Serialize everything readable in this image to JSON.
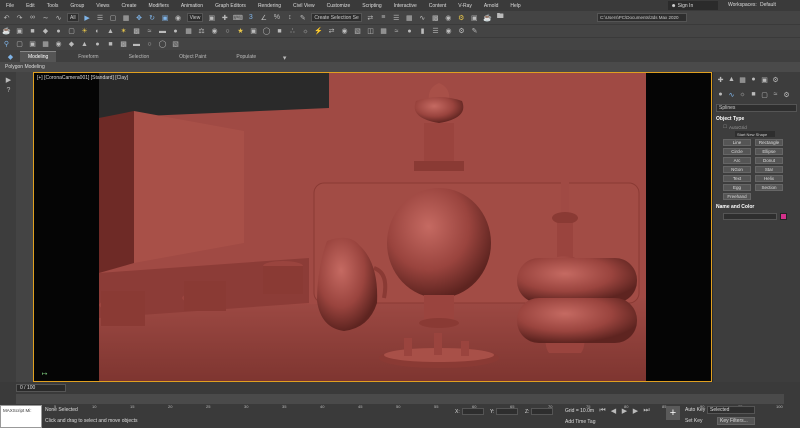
{
  "menubar": {
    "items": [
      "File",
      "Edit",
      "Tools",
      "Group",
      "Views",
      "Create",
      "Modifiers",
      "Animation",
      "Graph Editors",
      "Rendering",
      "Civil View",
      "Customize",
      "Scripting",
      "Interactive",
      "Content",
      "V-Ray",
      "Arnold",
      "Help"
    ],
    "sign_in": "Sign In",
    "workspaces_label": "Workspaces:",
    "workspace_value": "Default"
  },
  "toolbar": {
    "filter_value": "All",
    "view_value": "View",
    "selection_set": "Create Selection Se",
    "project_path": "C:\\Users\\PC\\Documents\\3ds Max 2020"
  },
  "ribbon": {
    "tabs": [
      "Modeling",
      "Freeform",
      "Selection",
      "Object Paint",
      "Populate"
    ],
    "sub_label": "Polygon Modeling"
  },
  "viewport": {
    "label": "[+] [CoronaCamera001] [Standard] [Clay]",
    "colors": {
      "bg": "#050505",
      "clay": "#a04a44",
      "border": "#e0a020"
    }
  },
  "command_panel": {
    "category": "Splines",
    "object_type_title": "Object Type",
    "autogrid": "AutoGrid",
    "start_new_shape": "Start New Shape",
    "buttons": [
      "Line",
      "Rectangle",
      "Circle",
      "Ellipse",
      "Arc",
      "Donut",
      "NGon",
      "Star",
      "Text",
      "Helix",
      "Egg",
      "Section",
      "Freehand"
    ],
    "name_color_title": "Name and Color",
    "swatch_color": "#d4308a"
  },
  "timeline": {
    "frame": "0 / 100",
    "ticks": [
      "0",
      "5",
      "10",
      "15",
      "20",
      "25",
      "30",
      "35",
      "40",
      "45",
      "50",
      "55",
      "60",
      "65",
      "70",
      "75",
      "80",
      "85",
      "90",
      "95",
      "100"
    ]
  },
  "status": {
    "maxscript": "MAXScript Mi:",
    "selection": "None Selected",
    "prompt": "Click and drag to select and move objects",
    "x_label": "X:",
    "y_label": "Y:",
    "z_label": "Z:",
    "grid": "Grid = 10.0m",
    "add_time_tag": "Add Time Tag",
    "auto_key": "Auto Key",
    "set_key": "Set Key",
    "selected_value": "Selected",
    "key_filters": "Key Filters..."
  }
}
